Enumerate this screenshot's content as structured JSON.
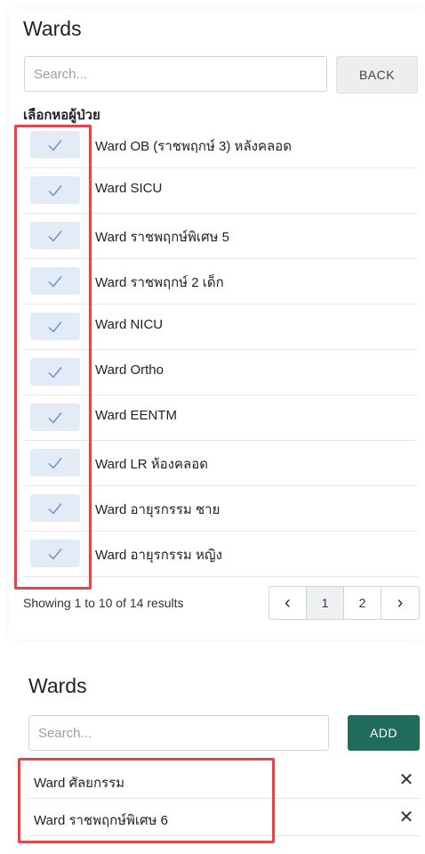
{
  "wards_panel": {
    "title": "Wards",
    "search_placeholder": "Search...",
    "back_label": "BACK",
    "section_label": "เลือกหอผู้ป่วย",
    "wards": [
      {
        "label": "Ward OB (ราชพฤกษ์ 3) หลังคลอด",
        "checked": true
      },
      {
        "label": "Ward SICU",
        "checked": true
      },
      {
        "label": "Ward ราชพฤกษ์พิเศษ 5",
        "checked": true
      },
      {
        "label": "Ward ราชพฤกษ์ 2 เด็ก",
        "checked": true
      },
      {
        "label": "Ward NICU",
        "checked": true
      },
      {
        "label": "Ward Ortho",
        "checked": true
      },
      {
        "label": "Ward EENTM",
        "checked": true
      },
      {
        "label": "Ward LR ห้องคลอด",
        "checked": true
      },
      {
        "label": "Ward อายุรกรรม ชาย",
        "checked": true
      },
      {
        "label": "Ward อายุรกรรม หญิง",
        "checked": true
      }
    ],
    "pagination": {
      "info": "Showing 1 to 10 of 14 results",
      "prev_icon": "‹",
      "pages": [
        "1",
        "2"
      ],
      "next_icon": "›"
    }
  },
  "selected_panel": {
    "title": "Wards",
    "search_placeholder": "Search...",
    "add_label": "ADD",
    "selected": [
      {
        "label": "Ward ศัลยกรรม",
        "remove_icon": "✕"
      },
      {
        "label": "Ward ราชพฤกษ์พิเศษ 6",
        "remove_icon": "✕"
      }
    ]
  },
  "colors": {
    "accent": "#1f6b5c",
    "checkbox_bg": "#e3ebf6",
    "check_mark": "#6a8fc7",
    "highlight_red": "#e0474c"
  }
}
